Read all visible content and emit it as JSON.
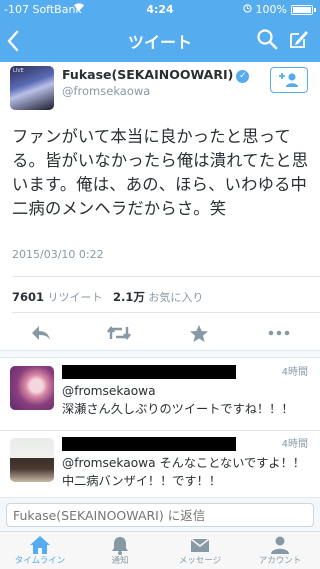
{
  "status": {
    "carrier": "-107 SoftBank",
    "time": "4:24",
    "battery": "100%"
  },
  "nav": {
    "title": "ツイート",
    "back_icon": "chevron-left-icon",
    "search_icon": "search-icon",
    "compose_icon": "compose-icon"
  },
  "profile": {
    "name": "Fukase(SEKAINOOWARI)",
    "handle": "@fromsekaowa",
    "follow_icon": "add-user-icon",
    "avatar_caption": "LIVE"
  },
  "tweet": {
    "text": "ファンがいて本当に良かったと思ってる。皆がいなかったら俺は潰れてたと思います。俺は、あの、ほら、いわゆる中二病のメンヘラだからさ。笑",
    "date": "2015/03/10 0:22",
    "retweets_count": "7601",
    "retweets_label": "リツイート",
    "favorites_count": "2.1万",
    "favorites_label": "お気に入り"
  },
  "actions": {
    "reply": "reply-icon",
    "retweet": "retweet-icon",
    "favorite": "star-icon",
    "more": "more-icon"
  },
  "replies": [
    {
      "time": "4時間",
      "text": "@fromsekaowa\n深瀬さん久しぶりのツイートですね！！！"
    },
    {
      "time": "4時間",
      "text": "@fromsekaowa そんなことないですよ！！\n中二病バンザイ！！です！！"
    }
  ],
  "reply_box": {
    "placeholder": "Fukase(SEKAINOOWARI) に返信"
  },
  "tabs": [
    {
      "label": "タイムライン",
      "icon": "home-icon",
      "active": true
    },
    {
      "label": "通知",
      "icon": "bell-icon",
      "active": false
    },
    {
      "label": "メッセージ",
      "icon": "envelope-icon",
      "active": false
    },
    {
      "label": "アカウント",
      "icon": "person-icon",
      "active": false
    }
  ],
  "colors": {
    "brand": "#55acee",
    "text": "#292f33",
    "muted": "#8899a6"
  }
}
